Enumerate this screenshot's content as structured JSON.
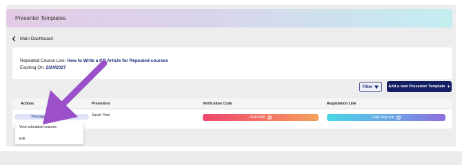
{
  "page": {
    "title": "Presenter Templates",
    "back_label": "Main Dashboard"
  },
  "course": {
    "repeated_label": "Repeated Course Live:",
    "course_name": "How to Write a KB Article for Repeated courses",
    "expiring_label": "Expiring On:",
    "expiring_date": "2/24/2027"
  },
  "toolbar": {
    "filter_label": "Filter",
    "add_label": "Add a new Presenter Template"
  },
  "table": {
    "headers": [
      "Actions",
      "Presenters",
      "Verification Code",
      "Registration Link"
    ],
    "row": {
      "manage_label": "Manage presenter template",
      "presenter": "Sarah Thiel",
      "verification_code": "VE4FH5B",
      "registration_label": "Copy Reg Link"
    }
  },
  "menu": {
    "items": [
      "View scheduled courses",
      "Edit"
    ]
  },
  "colors": {
    "accent": "#141f63",
    "annotation_arrow": "#9b4fc9"
  },
  "icons": [
    "chevron-left-icon",
    "filter-icon",
    "plus-icon",
    "kebab-icon",
    "copy-icon",
    "annotation-arrow"
  ]
}
